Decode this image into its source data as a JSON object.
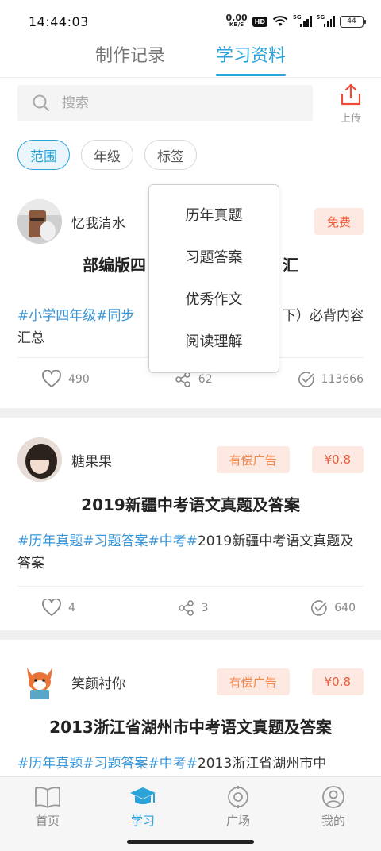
{
  "status_bar": {
    "time": "14:44:03",
    "net_speed_value": "0.00",
    "net_speed_unit": "KB/S",
    "hd": "HD",
    "signal_tag": "5G",
    "battery": "44"
  },
  "tabs": [
    {
      "label": "制作记录",
      "active": false
    },
    {
      "label": "学习资料",
      "active": true
    }
  ],
  "search": {
    "placeholder": "搜索"
  },
  "upload": {
    "label": "上传"
  },
  "filters": [
    {
      "label": "范围",
      "active": true
    },
    {
      "label": "年级",
      "active": false
    },
    {
      "label": "标签",
      "active": false
    }
  ],
  "dropdown": {
    "items": [
      "历年真题",
      "习题答案",
      "优秀作文",
      "阅读理解"
    ]
  },
  "cards": [
    {
      "author": "忆我清水",
      "badges": {
        "ad": "",
        "price": "免费"
      },
      "title_left": "部编版四",
      "title_right": "汇",
      "tags": "#小学四年级#同步",
      "desc_right": "下）必背内容",
      "desc_line2": "汇总",
      "likes": "490",
      "shares": "62",
      "views": "113666"
    },
    {
      "author": "糖果果",
      "badges": {
        "ad": "有偿广告",
        "price": "¥0.8"
      },
      "title": "2019新疆中考语文真题及答案",
      "tags": "#历年真题#习题答案#中考#",
      "desc": "2019新疆中考语文真题及答案",
      "likes": "4",
      "shares": "3",
      "views": "640"
    },
    {
      "author": "笑颜衬你",
      "badges": {
        "ad": "有偿广告",
        "price": "¥0.8"
      },
      "title": "2013浙江省湖州市中考语文真题及答案",
      "tags": "#历年真题#习题答案#中考#",
      "desc": "2013浙江省湖州市中"
    }
  ],
  "bottom_nav": [
    {
      "label": "首页",
      "icon": "book-icon",
      "active": false
    },
    {
      "label": "学习",
      "icon": "graduation-cap-icon",
      "active": true
    },
    {
      "label": "广场",
      "icon": "target-icon",
      "active": false
    },
    {
      "label": "我的",
      "icon": "profile-icon",
      "active": false
    }
  ],
  "colors": {
    "accent": "#2aa4d8",
    "price": "#ee5a3a",
    "ad": "#f2884a",
    "tag": "#3a95d6",
    "upload": "#ee4b3a"
  }
}
